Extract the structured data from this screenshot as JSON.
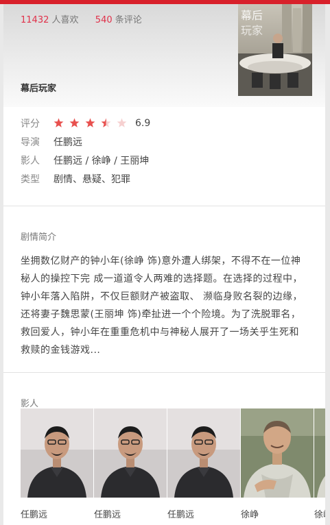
{
  "stats": {
    "likes": "11432",
    "likes_label": "人喜欢",
    "comments": "540",
    "comments_label": "条评论"
  },
  "title": "幕后玩家",
  "poster_text": "幕后玩家",
  "info": {
    "rating_label": "评分",
    "rating": 6.9,
    "rating_display": "6.9",
    "stars_filled": 3.5,
    "stars_total": 5,
    "director_label": "导演",
    "director": "任鹏远",
    "cast_label": "影人",
    "cast": "任鹏远 / 徐峥 / 王丽坤",
    "genre_label": "类型",
    "genre": "剧情、悬疑、犯罪"
  },
  "synopsis": {
    "heading": "剧情简介",
    "text": "坐拥数亿财产的钟小年(徐峥 饰)意外遭人绑架，不得不在一位神秘人的操控下完 成一道道令人两难的选择题。在选择的过程中，钟小年落入陷阱，不仅巨额财产被盗取、 濒临身败名裂的边缘，还将妻子魏思蒙(王丽坤 饰)牵扯进一个个险境。为了洗脱罪名， 救回爱人，钟小年在重重危机中与神秘人展开了一场关乎生死和救赎的金钱游戏..."
  },
  "cast_section": {
    "heading": "影人",
    "members": [
      {
        "name": "任鹏远",
        "photo": "actor-photo-ren"
      },
      {
        "name": "任鹏远",
        "photo": "actor-photo-ren"
      },
      {
        "name": "任鹏远",
        "photo": "actor-photo-ren"
      },
      {
        "name": "徐峥",
        "photo": "actor-photo-xu"
      },
      {
        "name": "徐峥",
        "photo": "actor-photo-xu"
      }
    ]
  },
  "colors": {
    "accent": "#d8202a",
    "count": "#e0314a",
    "star": "#e8504e",
    "star_empty": "#f6d0d0"
  }
}
